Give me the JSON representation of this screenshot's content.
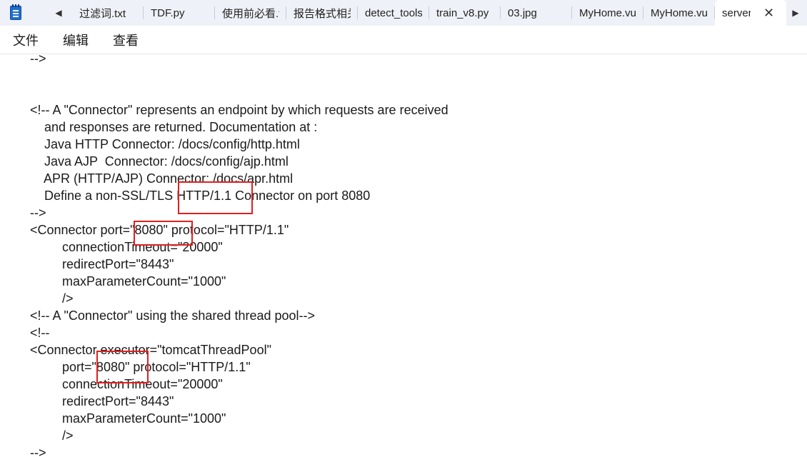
{
  "tabs": {
    "items": [
      {
        "label": "过滤词.txt"
      },
      {
        "label": "TDF.py"
      },
      {
        "label": "使用前必看.t"
      },
      {
        "label": "报告格式相关"
      },
      {
        "label": "detect_tools"
      },
      {
        "label": "train_v8.py"
      },
      {
        "label": "03.jpg"
      },
      {
        "label": "MyHome.vue"
      },
      {
        "label": "MyHome.vue"
      },
      {
        "label": "server"
      }
    ],
    "close_symbol": "✕",
    "scroll_left_symbol": "◀",
    "scroll_right_symbol": "▶"
  },
  "menu": {
    "file": "文件",
    "edit": "编辑",
    "view": "查看"
  },
  "editor": {
    "lines": [
      "-->",
      "",
      "",
      "<!-- A \"Connector\" represents an endpoint by which requests are received",
      "    and responses are returned. Documentation at :",
      "    Java HTTP Connector: /docs/config/http.html",
      "    Java AJP  Connector: /docs/config/ajp.html",
      "    APR (HTTP/AJP) Connector: /docs/apr.html",
      "    Define a non-SSL/TLS HTTP/1.1 Connector on port 8080",
      "-->",
      "<Connector port=\"8080\" protocol=\"HTTP/1.1\"",
      "         connectionTimeout=\"20000\"",
      "         redirectPort=\"8443\"",
      "         maxParameterCount=\"1000\"",
      "         />",
      "<!-- A \"Connector\" using the shared thread pool-->",
      "<!--",
      "<Connector executor=\"tomcatThreadPool\"",
      "         port=\"8080\" protocol=\"HTTP/1.1\"",
      "         connectionTimeout=\"20000\"",
      "         redirectPort=\"8443\"",
      "         maxParameterCount=\"1000\"",
      "         />",
      "-->"
    ]
  }
}
